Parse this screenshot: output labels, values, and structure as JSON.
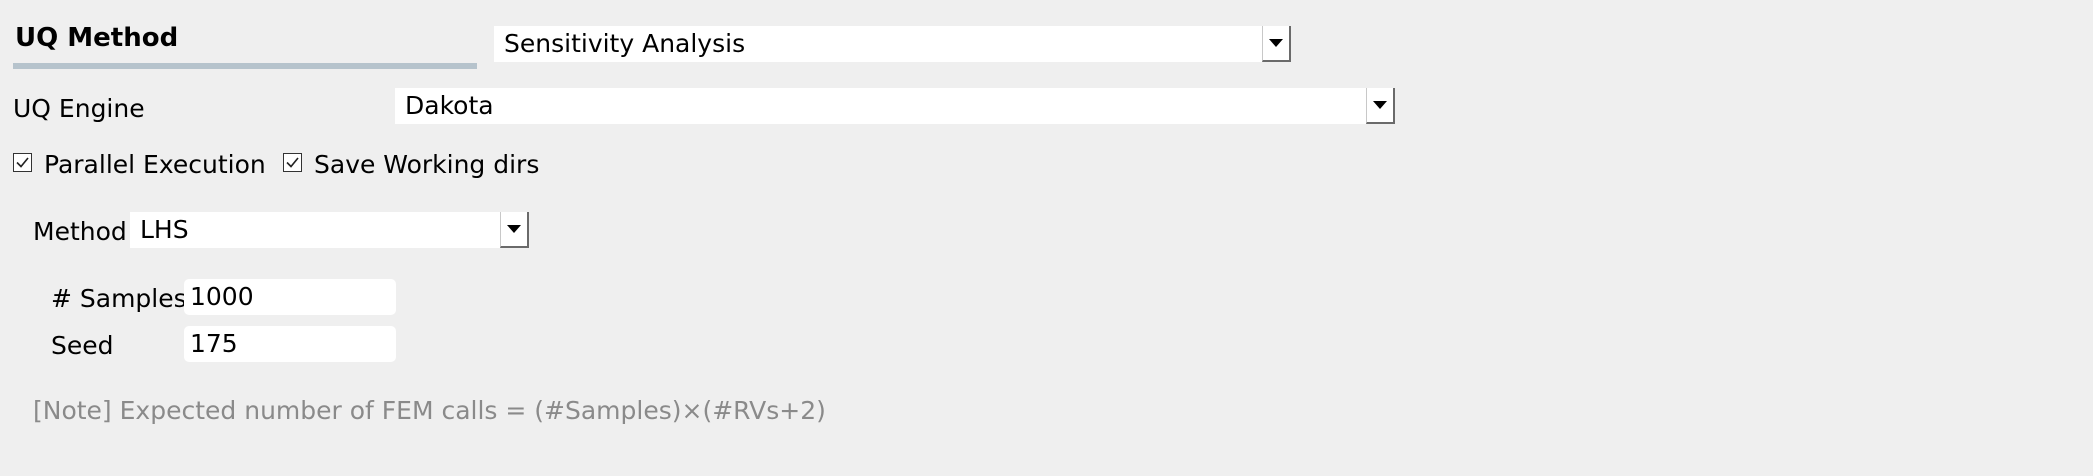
{
  "uq_method": {
    "title": "UQ Method",
    "selected": "Sensitivity Analysis"
  },
  "uq_engine": {
    "label": "UQ Engine",
    "selected": "Dakota"
  },
  "options": {
    "parallel_label": "Parallel Execution",
    "parallel_checked": true,
    "save_dirs_label": "Save Working dirs",
    "save_dirs_checked": true
  },
  "method": {
    "label": "Method",
    "selected": "LHS"
  },
  "samples": {
    "label": "# Samples",
    "value": "1000"
  },
  "seed": {
    "label": "Seed",
    "value": "175"
  },
  "note": "[Note] Expected number of FEM calls = (#Samples)×(#RVs+2)"
}
